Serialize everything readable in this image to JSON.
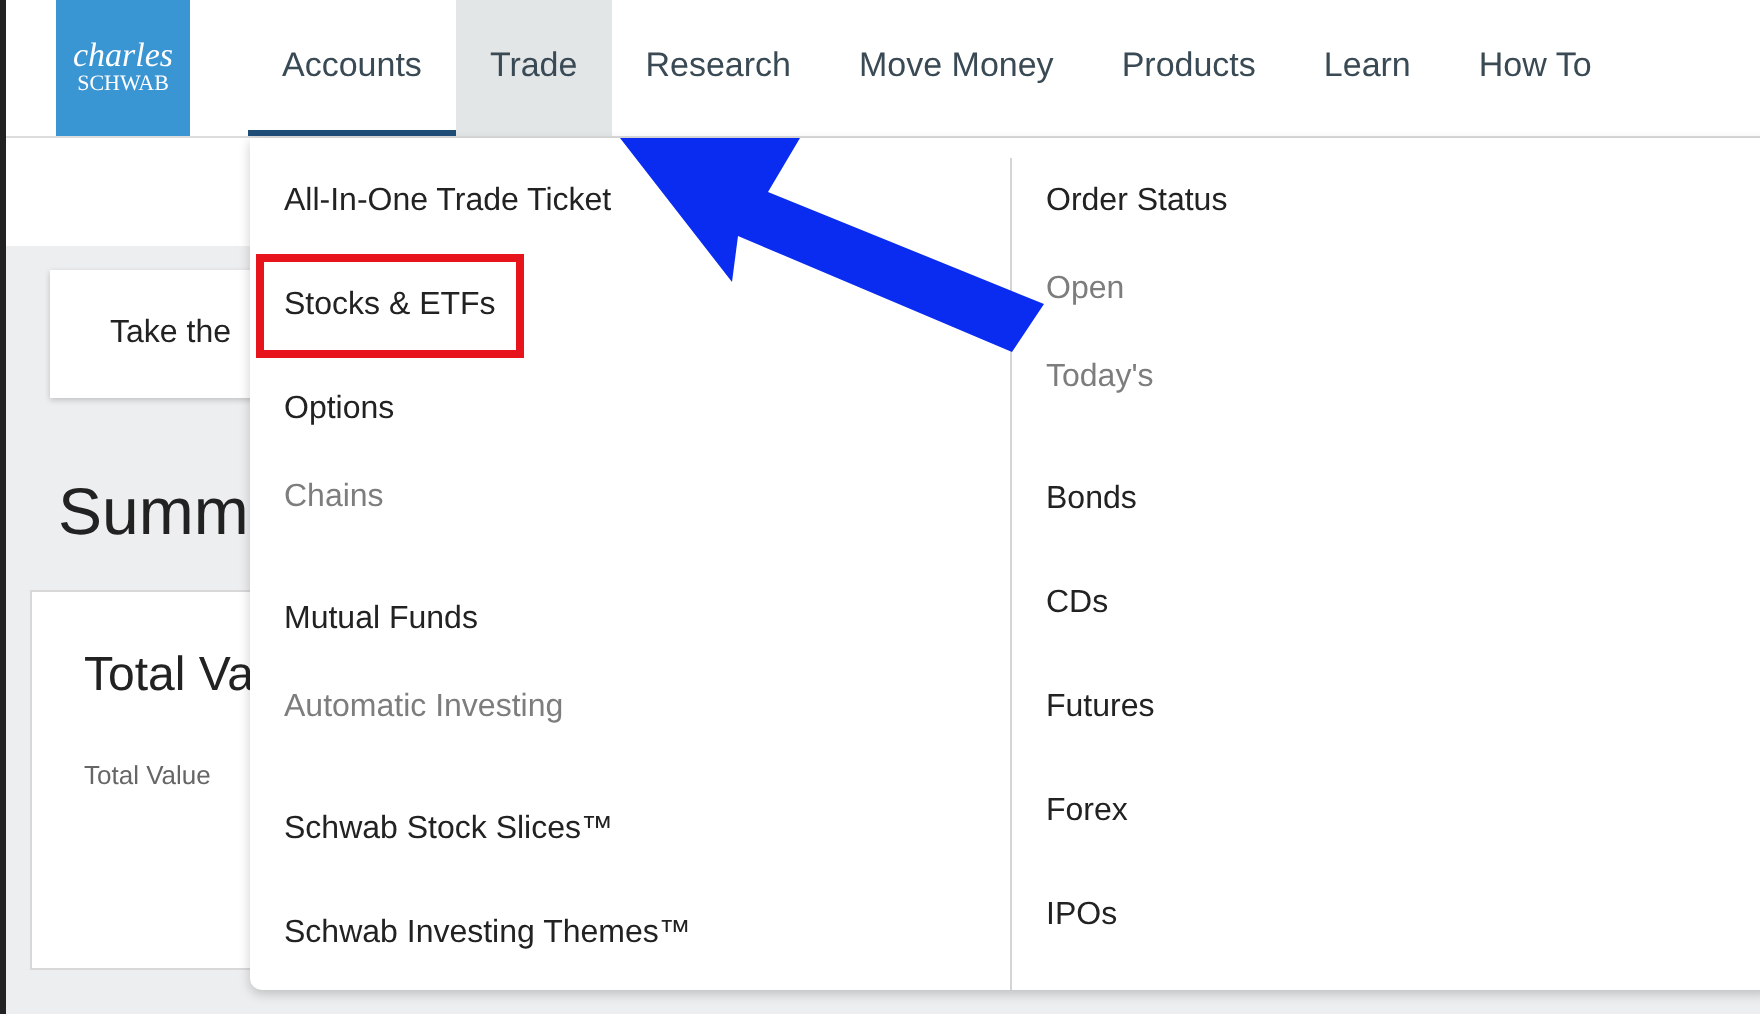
{
  "logo": {
    "line1": "charles",
    "line2": "SCHWAB"
  },
  "nav": [
    {
      "label": "Accounts",
      "selected": true,
      "open": false
    },
    {
      "label": "Trade",
      "selected": false,
      "open": true
    },
    {
      "label": "Research",
      "selected": false,
      "open": false
    },
    {
      "label": "Move Money",
      "selected": false,
      "open": false
    },
    {
      "label": "Products",
      "selected": false,
      "open": false
    },
    {
      "label": "Learn",
      "selected": false,
      "open": false
    },
    {
      "label": "How To",
      "selected": false,
      "open": false
    }
  ],
  "page": {
    "banner_text": "Take the",
    "heading": "Summ",
    "card_title": "Total Va",
    "card_label": "Total Value"
  },
  "dropdown": {
    "columns": [
      {
        "items": [
          {
            "label": "All-In-One Trade Ticket",
            "kind": "main",
            "highlighted": false
          },
          {
            "label": "Stocks & ETFs",
            "kind": "main",
            "highlighted": true
          },
          {
            "label": "Options",
            "kind": "main",
            "highlighted": false
          },
          {
            "label": "Chains",
            "kind": "sub",
            "highlighted": false
          },
          {
            "label": "Mutual Funds",
            "kind": "main",
            "highlighted": false
          },
          {
            "label": "Automatic Investing",
            "kind": "sub",
            "highlighted": false
          },
          {
            "label": "Schwab Stock Slices™",
            "kind": "main",
            "highlighted": false
          },
          {
            "label": "Schwab Investing Themes™",
            "kind": "main",
            "highlighted": false
          }
        ]
      },
      {
        "items": [
          {
            "label": "Order Status",
            "kind": "main",
            "highlighted": false
          },
          {
            "label": "Open",
            "kind": "sub",
            "highlighted": false
          },
          {
            "label": "Today's",
            "kind": "sub",
            "highlighted": false
          },
          {
            "label": "Bonds",
            "kind": "main",
            "highlighted": false
          },
          {
            "label": "CDs",
            "kind": "main",
            "highlighted": false
          },
          {
            "label": "Futures",
            "kind": "main",
            "highlighted": false
          },
          {
            "label": "Forex",
            "kind": "main",
            "highlighted": false
          },
          {
            "label": "IPOs",
            "kind": "main",
            "highlighted": false
          }
        ]
      }
    ]
  }
}
